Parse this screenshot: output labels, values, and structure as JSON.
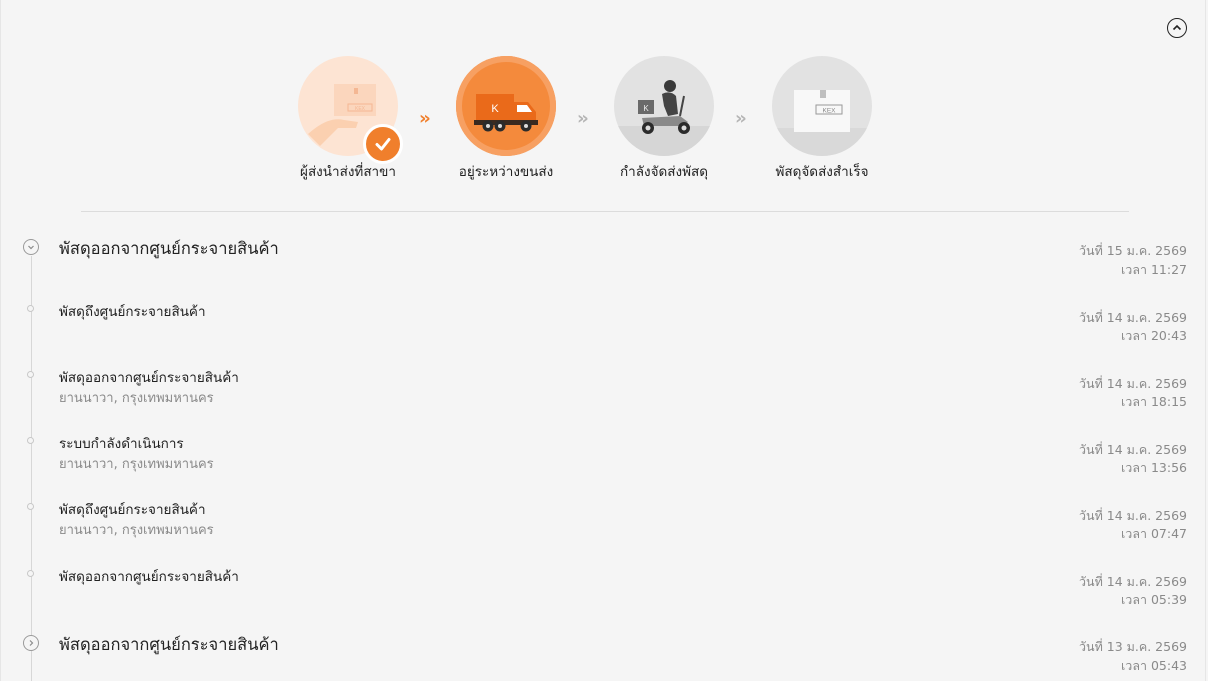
{
  "steps": [
    {
      "label": "ผู้ส่งนำส่งที่สาขา",
      "state": "done"
    },
    {
      "label": "อยู่ระหว่างขนส่ง",
      "state": "current"
    },
    {
      "label": "กำลังจัดส่งพัสดุ",
      "state": "pending"
    },
    {
      "label": "พัสดุจัดส่งสำเร็จ",
      "state": "pending"
    }
  ],
  "box_brand": "KEX",
  "truck_logo": "K",
  "colors": {
    "accent": "#f07f2c",
    "inactive": "#b5b5b5"
  },
  "events": [
    {
      "title": "พัสดุออกจากศูนย์กระจายสินค้า",
      "location": "",
      "date": "วันที่ 15 ม.ค. 2569",
      "time": "เวลา 11:27",
      "style": "group",
      "icon": "chevron-down-icon"
    },
    {
      "title": "พัสดุถึงศูนย์กระจายสินค้า",
      "location": "",
      "date": "วันที่ 14 ม.ค. 2569",
      "time": "เวลา 20:43",
      "style": "item"
    },
    {
      "title": "พัสดุออกจากศูนย์กระจายสินค้า",
      "location": "ยานนาวา, กรุงเทพมหานคร",
      "date": "วันที่ 14 ม.ค. 2569",
      "time": "เวลา 18:15",
      "style": "item"
    },
    {
      "title": "ระบบกำลังดำเนินการ",
      "location": "ยานนาวา, กรุงเทพมหานคร",
      "date": "วันที่ 14 ม.ค. 2569",
      "time": "เวลา 13:56",
      "style": "item"
    },
    {
      "title": "พัสดุถึงศูนย์กระจายสินค้า",
      "location": "ยานนาวา, กรุงเทพมหานคร",
      "date": "วันที่ 14 ม.ค. 2569",
      "time": "เวลา 07:47",
      "style": "item"
    },
    {
      "title": "พัสดุออกจากศูนย์กระจายสินค้า",
      "location": "",
      "date": "วันที่ 14 ม.ค. 2569",
      "time": "เวลา 05:39",
      "style": "item"
    },
    {
      "title": "พัสดุออกจากศูนย์กระจายสินค้า",
      "location": "",
      "date": "วันที่ 13 ม.ค. 2569",
      "time": "เวลา 05:43",
      "style": "group",
      "icon": "chevron-right-icon"
    }
  ]
}
